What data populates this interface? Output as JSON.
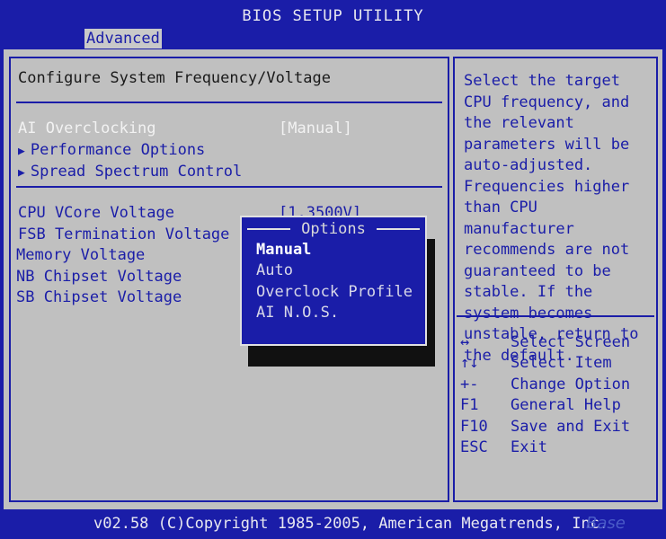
{
  "header": {
    "title": "BIOS SETUP UTILITY",
    "active_tab": "Advanced"
  },
  "section": {
    "title": "Configure System Frequency/Voltage"
  },
  "settings_group_1": [
    {
      "label": "AI Overclocking",
      "value": "[Manual]"
    },
    {
      "label": "Performance Options",
      "submenu": true
    },
    {
      "label": "Spread Spectrum Control",
      "submenu": true
    }
  ],
  "settings_group_2": [
    {
      "label": "CPU VCore Voltage",
      "value": "[1.3500V]"
    },
    {
      "label": "FSB Termination Voltage"
    },
    {
      "label": "Memory Voltage"
    },
    {
      "label": "NB Chipset Voltage"
    },
    {
      "label": "SB Chipset Voltage"
    }
  ],
  "options_popup": {
    "title": "Options",
    "options": [
      "Manual",
      "Auto",
      "Overclock Profile",
      "AI N.O.S."
    ],
    "selected_index": 0
  },
  "help": {
    "text": "Select the target CPU frequency, and the relevant parameters will be auto-adjusted. Frequencies higher than CPU manufacturer recommends are not guaranteed to be stable. If the system becomes unstable, return to the default.",
    "keys": [
      {
        "key": "↔",
        "desc": "Select Screen"
      },
      {
        "key": "↑↓",
        "desc": "Select Item"
      },
      {
        "key": "+-",
        "desc": "Change Option"
      },
      {
        "key": "F1",
        "desc": "General Help"
      },
      {
        "key": "F10",
        "desc": "Save and Exit"
      },
      {
        "key": "ESC",
        "desc": "Exit"
      }
    ]
  },
  "footer": {
    "copyright": "v02.58 (C)Copyright 1985-2005, American Megatrends, Inc.",
    "watermark": "Base"
  },
  "colors": {
    "bios_blue": "#1a1da8",
    "panel_gray": "#c0c0c0",
    "highlight_white": "#f2f2f2"
  }
}
